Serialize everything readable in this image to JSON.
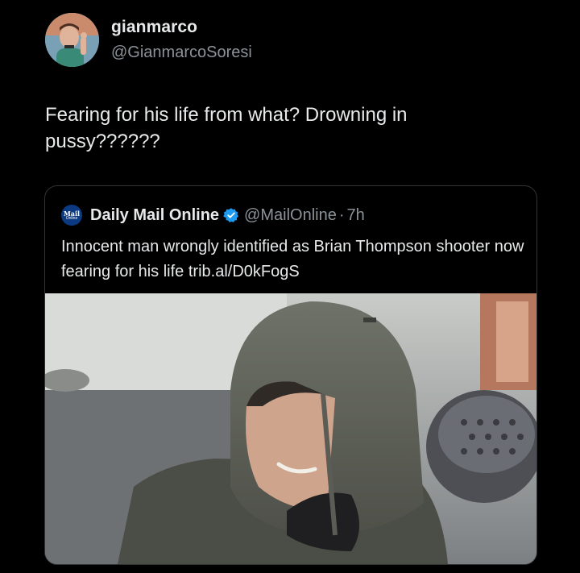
{
  "tweet": {
    "display_name": "gianmarco",
    "handle": "@GianmarcoSoresi",
    "text": "Fearing for his life from what? Drowning in pussy??????"
  },
  "quote": {
    "logo_line1": "Mail",
    "logo_line2": "Online",
    "display_name": "Daily Mail Online",
    "handle": "@MailOnline",
    "separator": "·",
    "time": "7h",
    "text": "Innocent man wrongly identified as Brian Thompson shooter now fearing for his life trib.al/D0kFogS",
    "verified_color": "#1d9bf0",
    "image_icon": "hooded-man-photo"
  },
  "colors": {
    "background": "#000000",
    "primary_text": "#e7e9ea",
    "secondary_text": "#8b9298",
    "card_border": "#2f3336"
  }
}
